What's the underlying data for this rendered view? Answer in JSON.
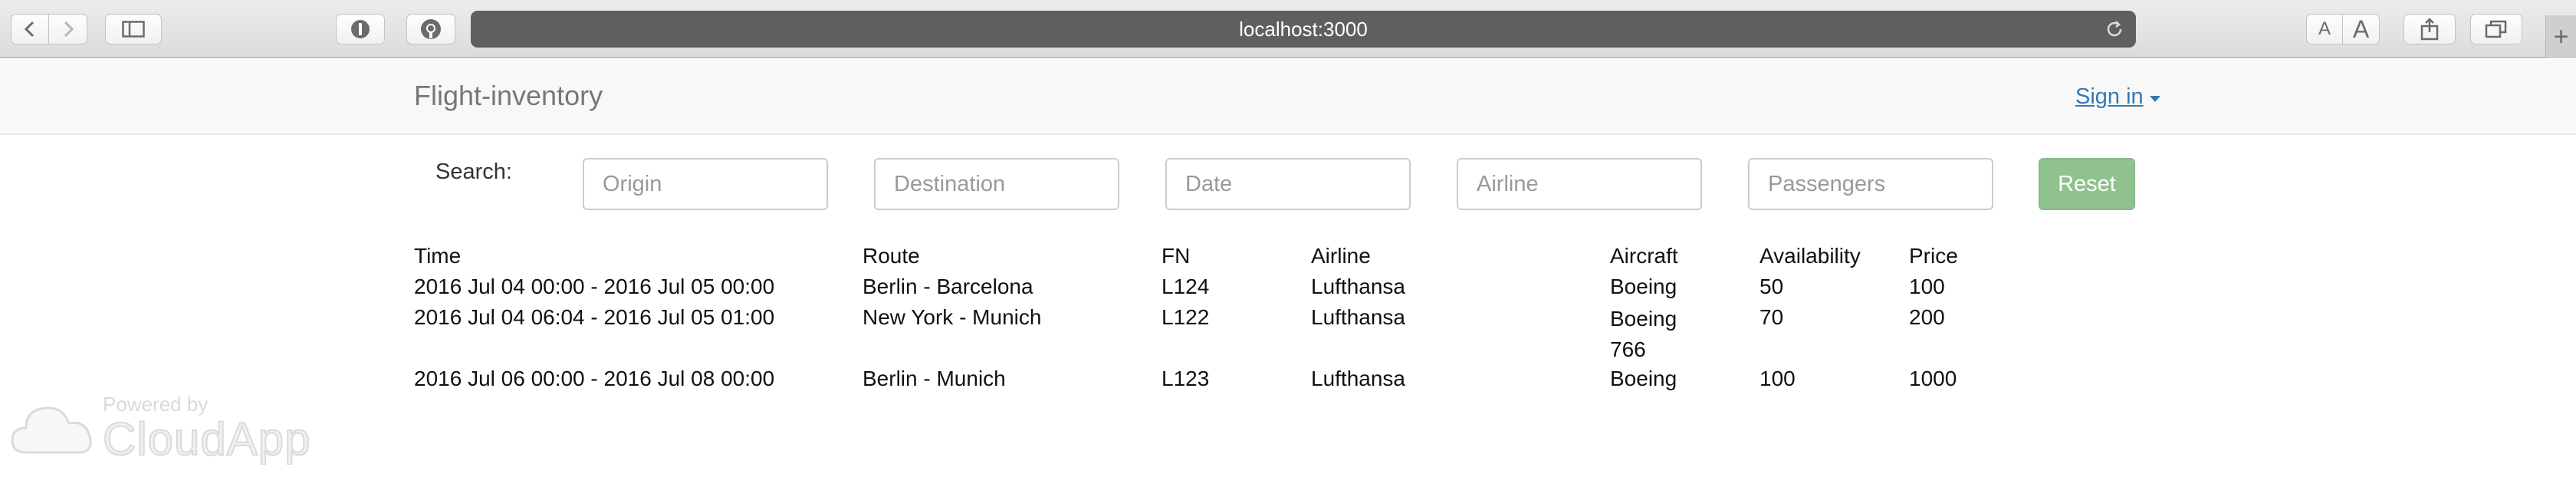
{
  "browser": {
    "url": "localhost:3000",
    "font_size_small": "A",
    "font_size_large": "A",
    "new_tab": "+"
  },
  "navbar": {
    "brand": "Flight-inventory",
    "signin": "Sign in"
  },
  "search": {
    "label": "Search:",
    "origin_placeholder": "Origin",
    "destination_placeholder": "Destination",
    "date_placeholder": "Date",
    "airline_placeholder": "Airline",
    "passengers_placeholder": "Passengers",
    "reset": "Reset"
  },
  "table": {
    "headers": [
      "Time",
      "Route",
      "FN",
      "Airline",
      "Aircraft",
      "Availability",
      "Price"
    ],
    "rows": [
      [
        "2016 Jul 04 00:00 - 2016 Jul 05 00:00",
        "Berlin - Barcelona",
        "L124",
        "Lufthansa",
        "Boeing",
        "50",
        "100"
      ],
      [
        "2016 Jul 04 06:04 - 2016 Jul 05 01:00",
        "New York - Munich",
        "L122",
        "Lufthansa",
        "Boeing 766",
        "70",
        "200"
      ],
      [
        "2016 Jul 06 00:00 - 2016 Jul 08 00:00",
        "Berlin - Munich",
        "L123",
        "Lufthansa",
        "Boeing",
        "100",
        "1000"
      ]
    ]
  },
  "watermark": {
    "small": "Powered by",
    "big": "CloudApp"
  },
  "colors": {
    "link": "#337ab7",
    "reset_button": "#8fc28f",
    "url_bar": "#5f5f5f"
  }
}
